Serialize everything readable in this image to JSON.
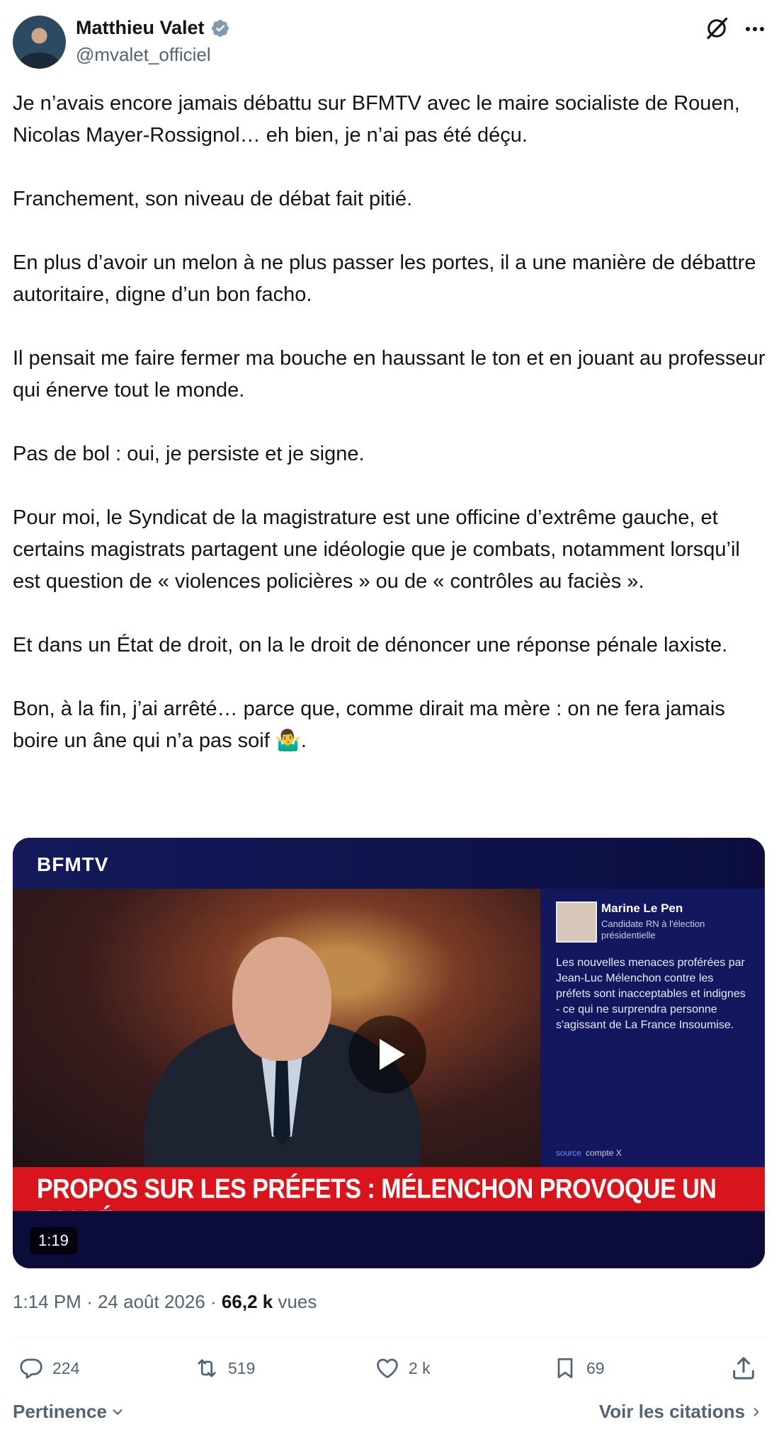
{
  "author": {
    "name": "Matthieu Valet",
    "handle": "@mvalet_officiel",
    "verified_badge": "verified-badge-icon"
  },
  "tweet": {
    "paragraphs": [
      "Je n’avais encore jamais débattu sur BFMTV avec le maire socialiste de Rouen, Nicolas Mayer-Rossignol… eh bien, je n’ai pas été déçu.",
      "Franchement, son niveau de débat fait pitié.",
      "En plus d’avoir un melon à ne plus passer les portes, il a une manière de débattre autoritaire, digne d’un bon facho.",
      "Il pensait me faire fermer ma bouche en haussant le ton et en jouant au professeur qui énerve tout le monde.",
      "Pas de bol : oui, je persiste et je signe.",
      "Pour moi, le Syndicat de la magistrature est une officine d’extrême gauche, et certains magistrats partagent une idéologie que je combats, notamment lorsqu’il est question de « violences policières » ou de « contrôles au faciès ».",
      "Et dans un État de droit, on la le droit de dénoncer une réponse pénale laxiste.",
      "Bon, à la fin, j’ai arrêté… parce que, comme dirait ma mère : on ne fera jamais boire un âne qui n’a pas soif 🤷‍♂️."
    ]
  },
  "video": {
    "channel_logo": "BFMTV",
    "panel_name": "Marine Le Pen",
    "panel_role": "Candidate RN à l'élection présidentielle",
    "panel_quote": "Les nouvelles menaces proférées par Jean-Luc Mélenchon contre les préfets sont inacceptables et indignes - ce qui ne surprendra personne s'agissant de La France Insoumise.",
    "panel_source_label": "source",
    "panel_source_value": "compte X",
    "headline": "PROPOS SUR LES PRÉFETS : MÉLENCHON PROVOQUE UN TOLLÉ",
    "duration": "1:19"
  },
  "meta": {
    "time": "1:14 PM",
    "separator": "·",
    "date": "24 août 2026",
    "views_count": "66,2 k",
    "views_label": "vues"
  },
  "actions": {
    "replies": "224",
    "reposts": "519",
    "likes": "2 k",
    "bookmarks": "69"
  },
  "footer": {
    "sort_label": "Pertinence",
    "quotes_link": "Voir les citations"
  },
  "colors": {
    "text": "#0f1419",
    "muted": "#536471",
    "verified": "#829aab",
    "headline_red": "#d8141c",
    "tv_blue": "#0c0e40"
  }
}
